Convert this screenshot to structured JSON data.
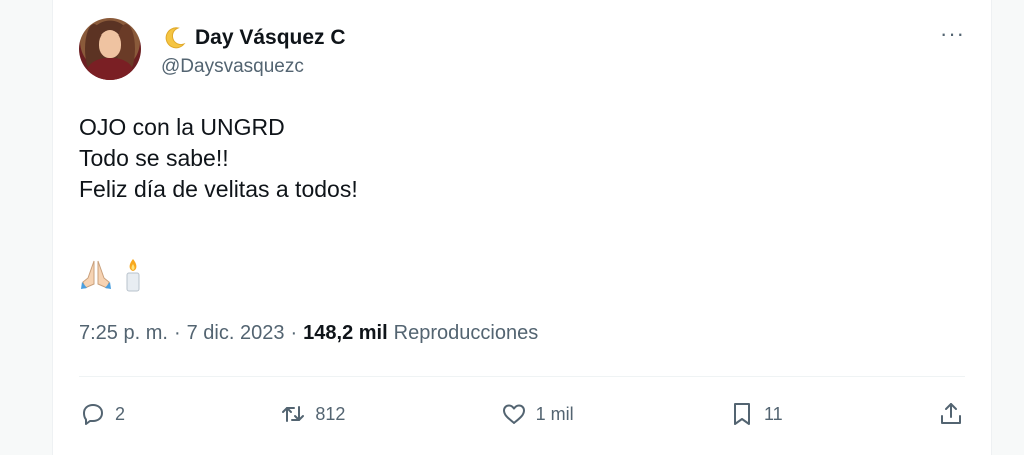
{
  "author": {
    "display_name": "Day Vásquez C",
    "handle": "@Daysvasquezc",
    "name_emoji": "crescent-moon"
  },
  "tweet": {
    "lines": [
      "OJO con la UNGRD",
      "Todo se sabe!!",
      "",
      "Feliz día de velitas a todos!"
    ],
    "emojis": [
      "folded-hands",
      "candle"
    ]
  },
  "meta": {
    "time": "7:25 p. m.",
    "separator": "·",
    "date": "7 dic. 2023",
    "views_count": "148,2 mil",
    "views_label": "Reproducciones"
  },
  "actions": {
    "replies": "2",
    "reposts": "812",
    "likes": "1 mil",
    "bookmarks": "11"
  },
  "more_menu": "···"
}
